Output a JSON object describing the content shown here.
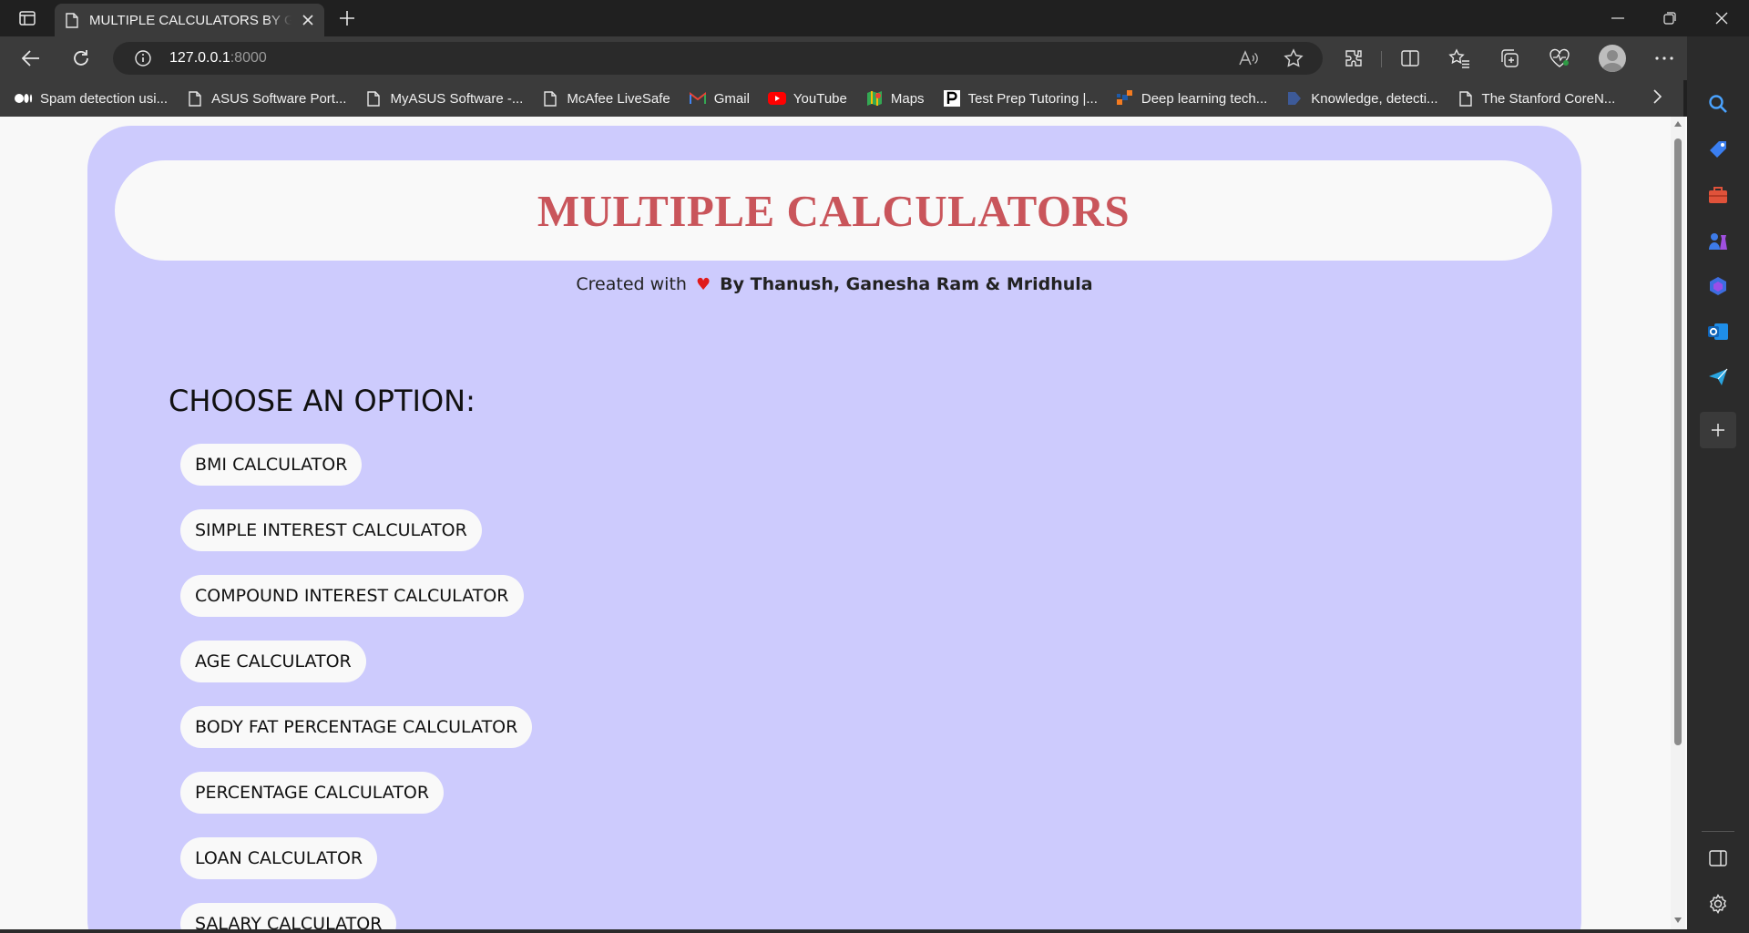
{
  "browser": {
    "tab_title": "MULTIPLE CALCULATORS BY GTM",
    "url_host": "127.0.0.1",
    "url_port": ":8000",
    "bookmarks": [
      {
        "label": "Spam detection usi...",
        "icon": "medium-icon"
      },
      {
        "label": "ASUS Software Port...",
        "icon": "page-icon"
      },
      {
        "label": "MyASUS Software -...",
        "icon": "page-icon"
      },
      {
        "label": "McAfee LiveSafe",
        "icon": "page-icon"
      },
      {
        "label": "Gmail",
        "icon": "gmail-icon"
      },
      {
        "label": "YouTube",
        "icon": "youtube-icon"
      },
      {
        "label": "Maps",
        "icon": "maps-icon"
      },
      {
        "label": "Test Prep Tutoring |...",
        "icon": "princeton-icon"
      },
      {
        "label": "Deep learning tech...",
        "icon": "ieee-icon"
      },
      {
        "label": "Knowledge, detecti...",
        "icon": "sciencedirect-icon"
      },
      {
        "label": "The Stanford CoreN...",
        "icon": "page-icon"
      }
    ]
  },
  "page": {
    "title": "MULTIPLE CALCULATORS",
    "credits_prefix": "Created with",
    "credits_heart": "♥",
    "credits_names": "By Thanush, Ganesha Ram & Mridhula",
    "choose_heading": "CHOOSE AN OPTION:",
    "options": [
      "BMI CALCULATOR",
      "SIMPLE INTEREST CALCULATOR",
      "COMPOUND INTEREST CALCULATOR",
      "AGE CALCULATOR",
      "BODY FAT PERCENTAGE CALCULATOR",
      "PERCENTAGE CALCULATOR",
      "LOAN CALCULATOR",
      "SALARY CALCULATOR"
    ]
  },
  "colors": {
    "card_background": "#cdcbfd",
    "title_color": "#c9555b",
    "heart_color": "#e01b1b"
  }
}
